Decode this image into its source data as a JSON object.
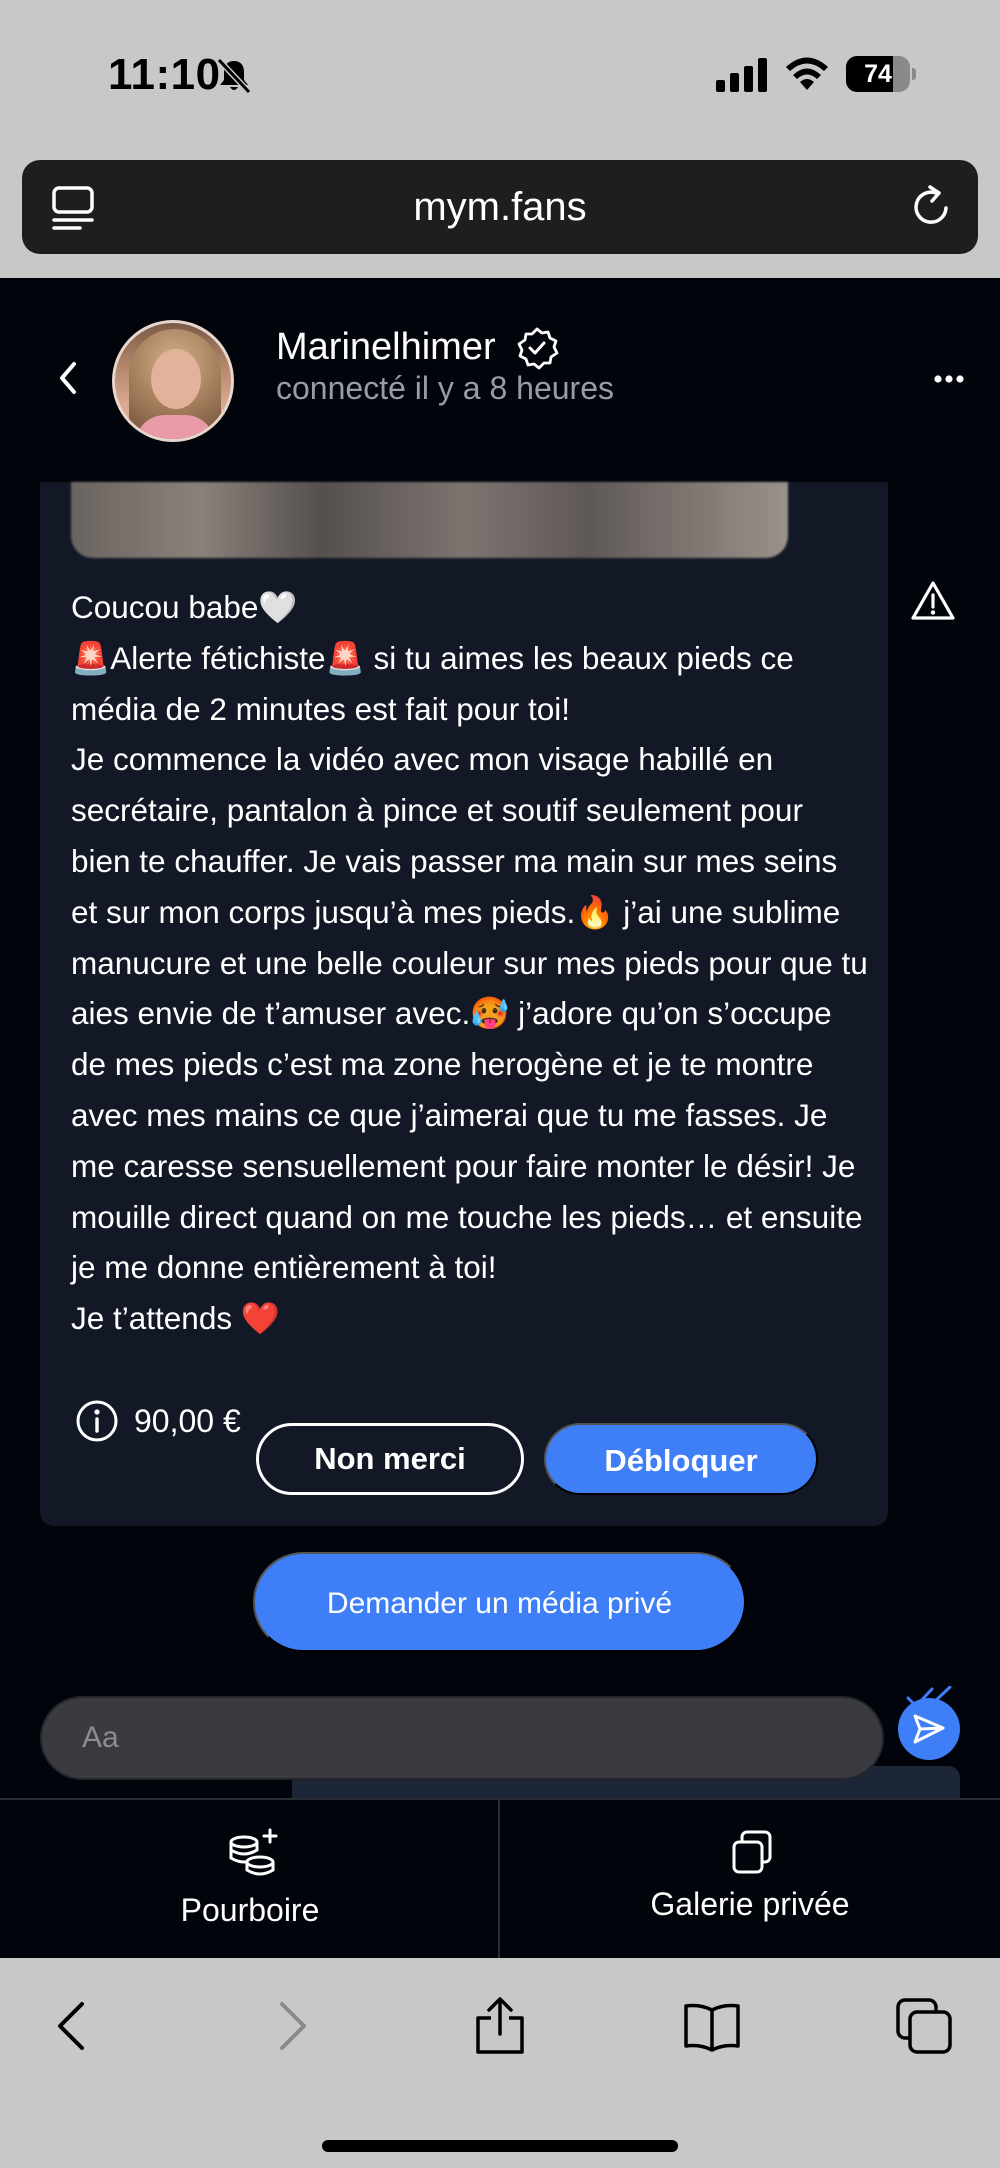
{
  "status_bar": {
    "time": "11:10",
    "battery_percent": "74",
    "battery_level": 0.74,
    "icons": [
      "bell-slash-icon",
      "cellular-signal-icon",
      "wifi-icon",
      "battery-icon"
    ]
  },
  "browser": {
    "url": "mym.fans",
    "icons": [
      "tab-menu-icon",
      "reload-icon"
    ]
  },
  "chat_header": {
    "username": "Marinelhimer",
    "presence": "connecté il y a 8 heures",
    "icons": [
      "back-chevron-icon",
      "verified-badge-icon",
      "more-dots-icon"
    ]
  },
  "message": {
    "text": "Coucou babe🤍\n🚨Alerte fétichiste🚨 si tu aimes les beaux pieds ce média de 2 minutes est fait pour toi!\nJe commence la vidéo avec mon visage habillé en secrétaire, pantalon à pince et soutif seulement pour bien te chauffer. Je vais passer ma main sur mes seins et sur mon corps jusqu’à mes pieds.🔥 j’ai une sublime manucure et une belle couleur sur mes pieds pour que tu aies envie de t’amuser avec.🥵 j’adore qu’on s’occupe de mes pieds c’est ma zone herogène et je te montre avec mes mains ce que j’aimerai que tu me fasses. Je me caresse sensuellement pour faire monter le désir! Je mouille direct quand on me touche les pieds… et ensuite je me donne entièrement à toi!\nJe t’attends ❤️",
    "price": "90,00 €",
    "decline_label": "Non merci",
    "unlock_label": "Débloquer"
  },
  "request_media_label": "Demander un média privé",
  "composer": {
    "placeholder": "Aa"
  },
  "tabs": [
    {
      "label": "Pourboire",
      "icon": "coins-plus-icon"
    },
    {
      "label": "Galerie privée",
      "icon": "gallery-stack-icon"
    }
  ],
  "safari_toolbar": {
    "icons": [
      "back-arrow-icon",
      "forward-arrow-icon",
      "share-icon",
      "bookmarks-icon",
      "tabs-icon"
    ]
  },
  "colors": {
    "accent": "#3e7ef7",
    "app_background": "#02040b",
    "card_background": "#131826",
    "browser_chrome": "#c8c8c8"
  }
}
